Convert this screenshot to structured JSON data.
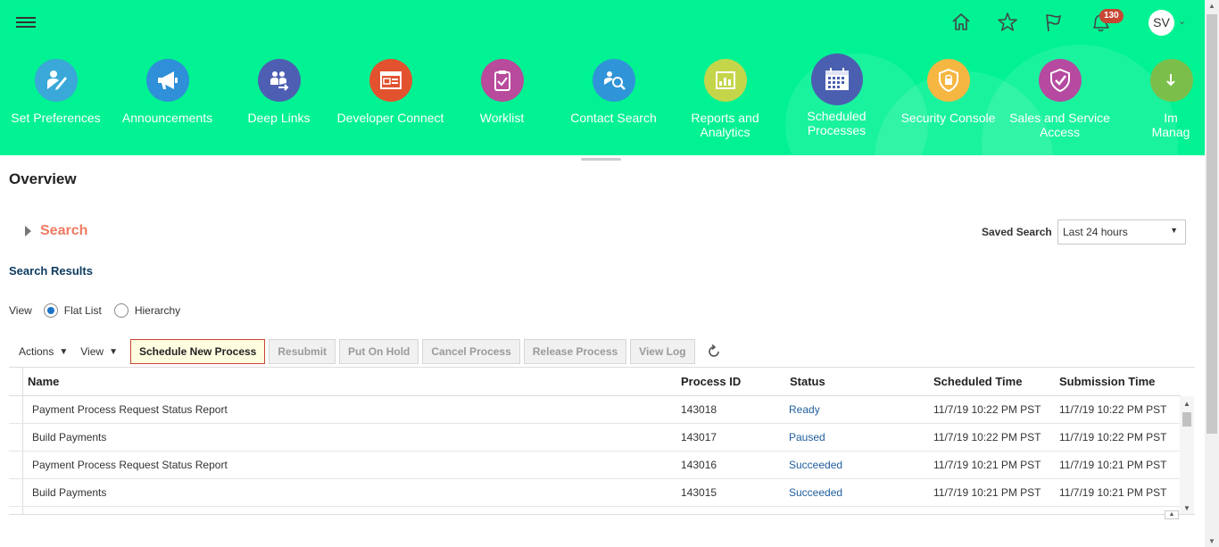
{
  "header": {
    "notification_count": "130",
    "user_initials": "SV",
    "apps": [
      {
        "label": "Set Preferences",
        "color": "#3aa8d8"
      },
      {
        "label": "Announcements",
        "color": "#2f8fd8"
      },
      {
        "label": "Deep Links",
        "color": "#4e5fb3"
      },
      {
        "label": "Developer Connect",
        "color": "#e2522f"
      },
      {
        "label": "Worklist",
        "color": "#b84b9b"
      },
      {
        "label": "Contact Search",
        "color": "#2f95d8"
      },
      {
        "label": "Reports and Analytics",
        "color": "#c4d54a"
      },
      {
        "label": "Scheduled Processes",
        "color": "#4b5fb0"
      },
      {
        "label": "Security Console",
        "color": "#f5b642"
      },
      {
        "label": "Sales and Service Access",
        "color": "#b54aa0"
      },
      {
        "label": "Im Manag",
        "color": "#7bbf4a"
      }
    ]
  },
  "page": {
    "title": "Overview",
    "search_label": "Search",
    "saved_search_label": "Saved Search",
    "saved_search_value": "Last 24 hours",
    "results_title": "Search Results",
    "view_label": "View",
    "view_flat": "Flat List",
    "view_hierarchy": "Hierarchy"
  },
  "toolbar": {
    "actions": "Actions",
    "view": "View",
    "schedule_new": "Schedule New Process",
    "resubmit": "Resubmit",
    "put_on_hold": "Put On Hold",
    "cancel_process": "Cancel Process",
    "release_process": "Release Process",
    "view_log": "View Log"
  },
  "table": {
    "columns": [
      "Name",
      "Process ID",
      "Status",
      "Scheduled Time",
      "Submission Time"
    ],
    "rows": [
      {
        "name": "Payment Process Request Status Report",
        "id": "143018",
        "status": "Ready",
        "scheduled": "11/7/19 10:22 PM PST",
        "submitted": "11/7/19 10:22 PM PST"
      },
      {
        "name": "Build Payments",
        "id": "143017",
        "status": "Paused",
        "scheduled": "11/7/19 10:22 PM PST",
        "submitted": "11/7/19 10:22 PM PST"
      },
      {
        "name": "Payment Process Request Status Report",
        "id": "143016",
        "status": "Succeeded",
        "scheduled": "11/7/19 10:21 PM PST",
        "submitted": "11/7/19 10:21 PM PST"
      },
      {
        "name": "Build Payments",
        "id": "143015",
        "status": "Succeeded",
        "scheduled": "11/7/19 10:21 PM PST",
        "submitted": "11/7/19 10:21 PM PST"
      }
    ]
  }
}
